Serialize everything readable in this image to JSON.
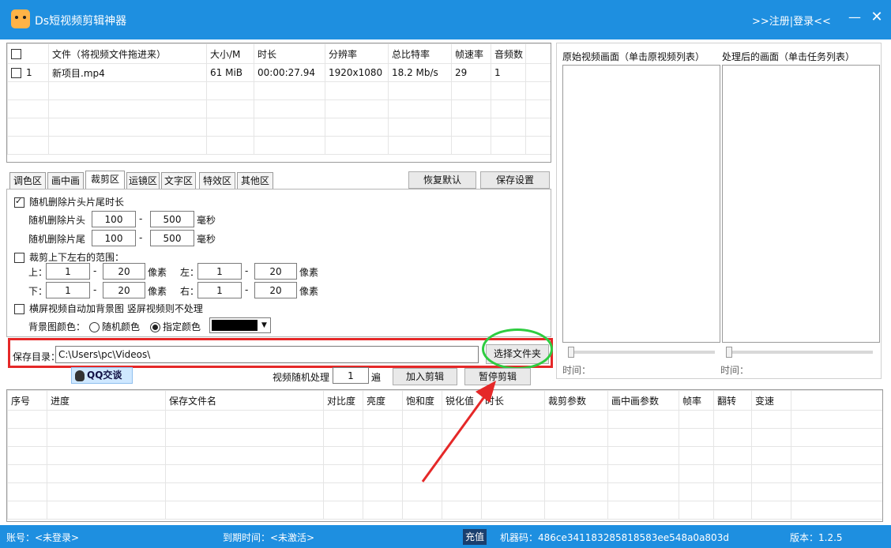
{
  "titlebar": {
    "app_title": "Ds短视频剪辑神器",
    "login_link": ">>注册|登录<<",
    "minimize_glyph": "—",
    "close_glyph": "✕"
  },
  "file_table": {
    "columns": [
      "文件（将视频文件拖进来）",
      "大小/M",
      "时长",
      "分辨率",
      "总比特率",
      "帧速率",
      "音频数"
    ],
    "rows": [
      {
        "index": "1",
        "file": "新项目.mp4",
        "size": "61 MiB",
        "duration": "00:00:27.94",
        "resolution": "1920x1080",
        "bitrate": "18.2 Mb/s",
        "fps": "29",
        "audio": "1"
      }
    ]
  },
  "preview": {
    "original_label": "原始视频画面（单击原视频列表）",
    "processed_label": "处理后的画面（单击任务列表）",
    "time_label_left": "时间：",
    "time_label_right": "时间："
  },
  "tabs": [
    {
      "label": "调色区",
      "active": false
    },
    {
      "label": "画中画",
      "active": false
    },
    {
      "label": "裁剪区",
      "active": true
    },
    {
      "label": "运镜区",
      "active": false
    },
    {
      "label": "文字区",
      "active": false
    },
    {
      "label": "特效区",
      "active": false
    },
    {
      "label": "其他区",
      "active": false
    }
  ],
  "toolbar": {
    "restore_default_label": "恢复默认",
    "save_settings_label": "保存设置"
  },
  "crop": {
    "random_trim_label": "随机删除片头片尾时长",
    "head_label": "随机删除片头",
    "head_min": "100",
    "head_max": "500",
    "head_unit": "毫秒",
    "tail_label": "随机删除片尾",
    "tail_min": "100",
    "tail_max": "500",
    "tail_unit": "毫秒",
    "dash": "-",
    "range_label": "裁剪上下左右的范围：",
    "top_label": "上：",
    "top_min": "1",
    "top_max": "20",
    "left_label": "左：",
    "left_min": "1",
    "left_max": "20",
    "bottom_label": "下：",
    "bottom_min": "1",
    "bottom_max": "20",
    "right_label": "右：",
    "right_min": "1",
    "right_max": "20",
    "pixel_unit": "像素",
    "bg_label": "横屏视频自动加背景图 竖屏视频则不处理",
    "bg_color_label": "背景图颜色：",
    "random_color_label": "随机颜色",
    "custom_color_label": "指定颜色",
    "swatch_color": "#000000"
  },
  "save": {
    "label": "保存目录：",
    "path": "C:\\Users\\pc\\Videos\\",
    "choose_folder_label": "选择文件夹"
  },
  "actions": {
    "qq_label": "QQ交谈",
    "random_process_label": "视频随机处理",
    "random_count": "1",
    "random_unit": "遍",
    "add_clip_label": "加入剪辑",
    "pause_clip_label": "暂停剪辑"
  },
  "task_table": {
    "columns": [
      "序号",
      "进度",
      "保存文件名",
      "对比度",
      "亮度",
      "饱和度",
      "锐化值",
      "时长",
      "裁剪参数",
      "画中画参数",
      "帧率",
      "翻转",
      "变速"
    ]
  },
  "status": {
    "account": "账号：<未登录>",
    "expiry": "到期时间：<未激活>",
    "recharge_label": "充值",
    "machine_code": "机器码：486ce341183285818583ee548a0a803d",
    "version": "版本：1.2.5"
  },
  "colors": {
    "titlebar": "#1e8fe0",
    "highlight_rect": "#e52828",
    "highlight_ellipse": "#2ecc40",
    "arrow": "#e52828"
  }
}
